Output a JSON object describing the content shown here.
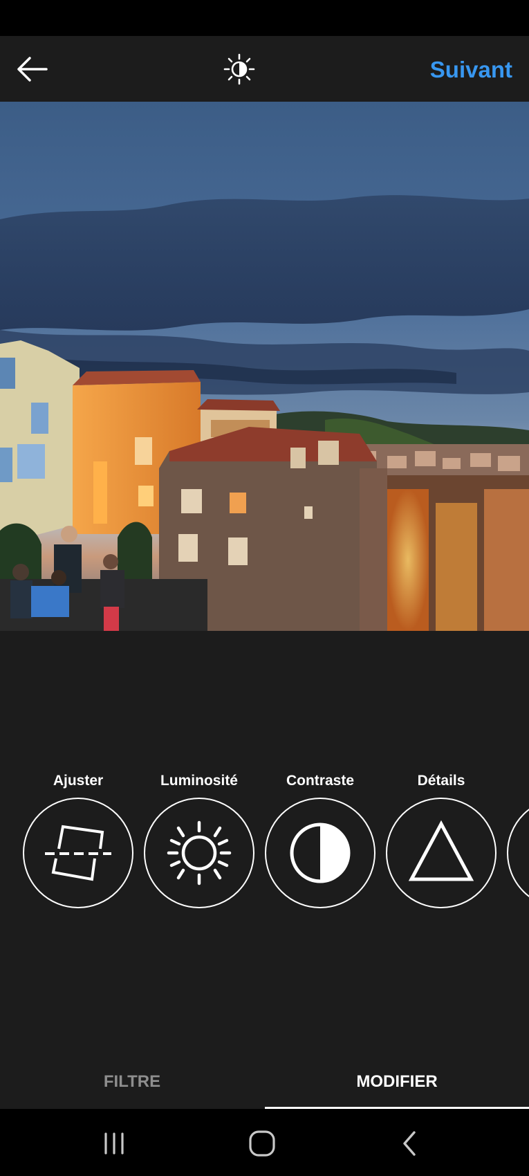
{
  "header": {
    "back_icon": "arrow-left-icon",
    "lux_icon": "lux-sun-icon",
    "next_label": "Suivant",
    "accent_color": "#3897f0"
  },
  "photo": {
    "description_icon": "photo-preview"
  },
  "tools": [
    {
      "label": "Ajuster",
      "icon": "adjust-icon"
    },
    {
      "label": "Luminosité",
      "icon": "brightness-icon"
    },
    {
      "label": "Contraste",
      "icon": "contrast-icon"
    },
    {
      "label": "Détails",
      "icon": "details-icon"
    },
    {
      "label": "",
      "icon": "partial-tool-icon"
    }
  ],
  "tabs": {
    "filter_label": "FILTRE",
    "edit_label": "MODIFIER",
    "active": "MODIFIER"
  },
  "nav": {
    "recents_icon": "recents-icon",
    "home_icon": "home-icon",
    "back_icon": "nav-back-icon"
  }
}
